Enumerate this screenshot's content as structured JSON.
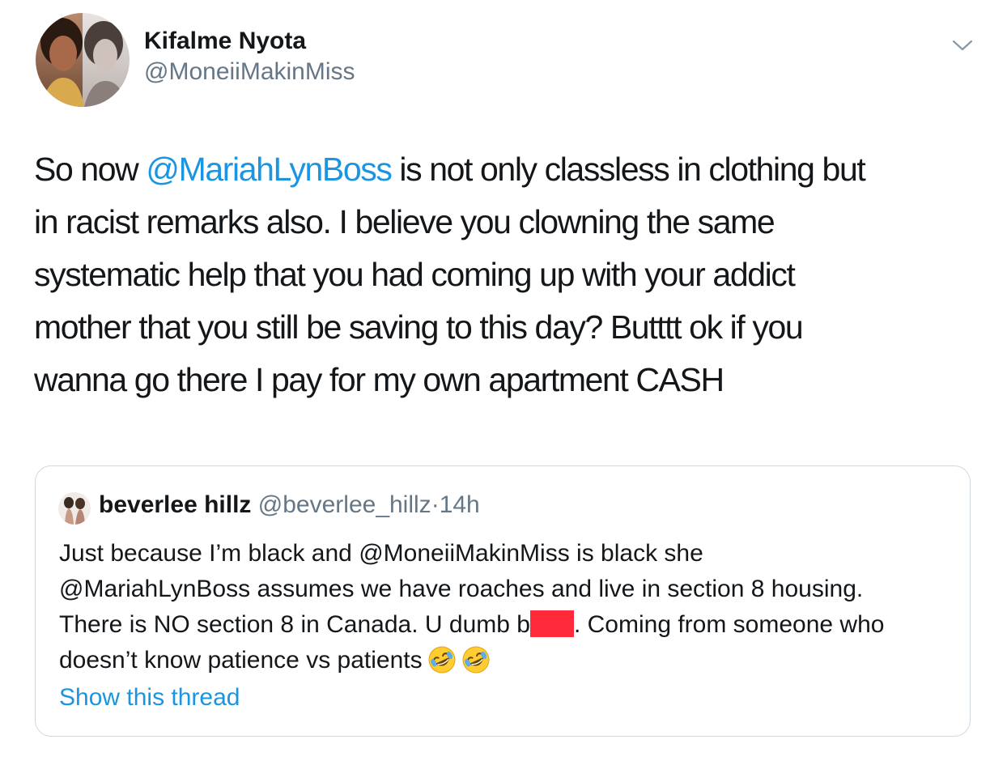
{
  "tweet": {
    "author": {
      "display_name": "Kifalme Nyota",
      "username": "@MoneiiMakinMiss",
      "avatar_icon": "profile-photo"
    },
    "menu_icon": "chevron-down-icon",
    "text": {
      "line1_before": "So now ",
      "line1_mention": "@MariahLynBoss",
      "line1_after": " is not only classless in clothing but",
      "line2": "in racist remarks also. I believe you clowning the same",
      "line3": "systematic help that you had coming up with your addict",
      "line4": "mother that you still be saving to this day? Butttt ok if you",
      "line5": "wanna go there I pay for my own apartment CASH"
    }
  },
  "quoted_tweet": {
    "author": {
      "display_name": "beverlee hillz",
      "username": "@beverlee_hillz",
      "separator": "·",
      "time": "14h",
      "avatar_icon": "profile-photo"
    },
    "text": {
      "line1": "Just because I’m black and @MoneiiMakinMiss is black she",
      "line2": "@MariahLynBoss assumes we have roaches and live in section 8 housing.",
      "line3_before": "There is NO section 8 in Canada. U dumb b",
      "line3_after": ". Coming from someone who",
      "line4": "doesn’t know patience vs patients"
    },
    "emoji_icons": [
      "rolling-on-floor-laughing-emoji",
      "rolling-on-floor-laughing-emoji"
    ],
    "show_thread_label": "Show this thread"
  },
  "colors": {
    "link": "#1b95e0",
    "secondary_text": "#657786",
    "primary_text": "#14171a",
    "card_border": "#cfd9de",
    "redaction": "#ff2b3a"
  }
}
